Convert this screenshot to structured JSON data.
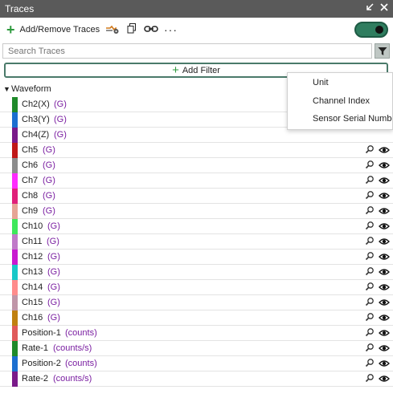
{
  "window": {
    "title": "Traces"
  },
  "toolbar": {
    "add_remove_label": "Add/Remove Traces",
    "more_label": "···"
  },
  "search": {
    "placeholder": "Search Traces"
  },
  "add_filter_label": "Add Filter",
  "tree": {
    "group_label": "Waveform",
    "rows": [
      {
        "name": "Ch2(X)",
        "unit": "(G)",
        "color": "#1f8a2a"
      },
      {
        "name": "Ch3(Y)",
        "unit": "(G)",
        "color": "#1b6fd0"
      },
      {
        "name": "Ch4(Z)",
        "unit": "(G)",
        "color": "#7a1a8a"
      },
      {
        "name": "Ch5",
        "unit": "(G)",
        "color": "#c01818"
      },
      {
        "name": "Ch6",
        "unit": "(G)",
        "color": "#8c8c8c"
      },
      {
        "name": "Ch7",
        "unit": "(G)",
        "color": "#ff2bff"
      },
      {
        "name": "Ch8",
        "unit": "(G)",
        "color": "#e0207a"
      },
      {
        "name": "Ch9",
        "unit": "(G)",
        "color": "#e6a596"
      },
      {
        "name": "Ch10",
        "unit": "(G)",
        "color": "#3ee85a"
      },
      {
        "name": "Ch11",
        "unit": "(G)",
        "color": "#c07ac8"
      },
      {
        "name": "Ch12",
        "unit": "(G)",
        "color": "#c81ad0"
      },
      {
        "name": "Ch13",
        "unit": "(G)",
        "color": "#18c8c8"
      },
      {
        "name": "Ch14",
        "unit": "(G)",
        "color": "#ff8c8c"
      },
      {
        "name": "Ch15",
        "unit": "(G)",
        "color": "#c096a8"
      },
      {
        "name": "Ch16",
        "unit": "(G)",
        "color": "#c08010"
      },
      {
        "name": "Position-1",
        "unit": "(counts)",
        "color": "#e05a5a"
      },
      {
        "name": "Rate-1",
        "unit": "(counts/s)",
        "color": "#1f8a2a"
      },
      {
        "name": "Position-2",
        "unit": "(counts)",
        "color": "#1b6fd0"
      },
      {
        "name": "Rate-2",
        "unit": "(counts/s)",
        "color": "#7a1a8a"
      }
    ]
  },
  "filter_menu": {
    "items": [
      "Unit",
      "Channel Index",
      "Sensor Serial Number"
    ]
  },
  "colors": {
    "toggle_on": "#2f7d5f",
    "unit_text": "#7a1ea1",
    "add_green": "#2e9a3e",
    "titlebar": "#5a5a5a"
  }
}
